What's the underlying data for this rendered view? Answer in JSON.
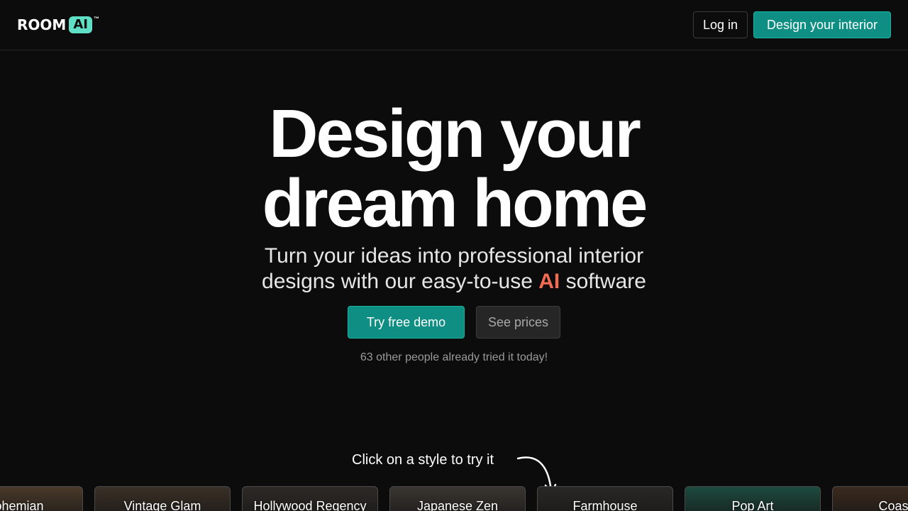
{
  "header": {
    "logo_word": "ROOM",
    "logo_badge": "AI",
    "logo_tm": "™",
    "login_label": "Log in",
    "cta_label": "Design your interior"
  },
  "hero": {
    "title_line1": "Design your",
    "title_line2": "dream home",
    "subtitle_part1": "Turn your ideas into professional interior",
    "subtitle_part2": "designs with our easy-to-use",
    "subtitle_highlight": "AI",
    "subtitle_part3": "software",
    "demo_label": "Try free demo",
    "prices_label": "See prices",
    "social_proof": "63 other people already tried it today!"
  },
  "styles": {
    "hint": "Click on a style to try it",
    "items": [
      {
        "label": "Bohemian",
        "bg": "#4a3a2a"
      },
      {
        "label": "Vintage Glam",
        "bg": "#3a3026"
      },
      {
        "label": "Hollywood Regency",
        "bg": "#2e2a26"
      },
      {
        "label": "Japanese Zen",
        "bg": "#3a3530"
      },
      {
        "label": "Farmhouse",
        "bg": "#2a2826"
      },
      {
        "label": "Pop Art",
        "bg": "#1d4a3e"
      },
      {
        "label": "Coastal",
        "bg": "#3a2a1e"
      }
    ]
  },
  "colors": {
    "accent": "#0f8f83",
    "highlight": "#f26b52",
    "background": "#0c0c0c"
  }
}
